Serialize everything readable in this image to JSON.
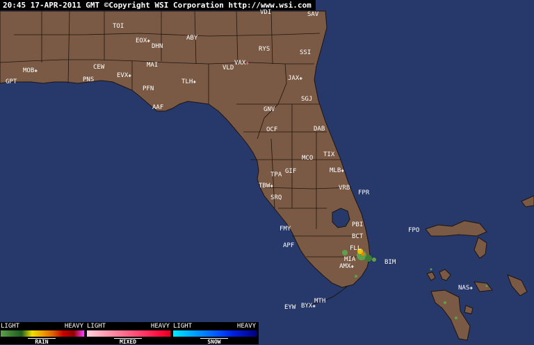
{
  "header": {
    "text": "20:45 17-APR-2011 GMT ©Copyright WSI Corporation  http://www.wsi.com"
  },
  "colors": {
    "water": "#27386a",
    "land": "#7a5a44",
    "border": "#1e1410",
    "text": "#ffffff",
    "station_marker": "#ffffff",
    "highlight_marker": "#ff69b4"
  },
  "stations": [
    {
      "code": "VDI",
      "marker": false
    },
    {
      "code": "SAV",
      "marker": false
    },
    {
      "code": "TOI",
      "marker": false
    },
    {
      "code": "EOX",
      "marker": true
    },
    {
      "code": "DHN",
      "marker": false
    },
    {
      "code": "ABY",
      "marker": false
    },
    {
      "code": "RYS",
      "marker": false
    },
    {
      "code": "SSI",
      "marker": false
    },
    {
      "code": "MOB",
      "marker": true
    },
    {
      "code": "CEW",
      "marker": false
    },
    {
      "code": "MAI",
      "marker": false
    },
    {
      "code": "VAX",
      "marker": true,
      "highlight": true
    },
    {
      "code": "VLD",
      "marker": false
    },
    {
      "code": "EVX",
      "marker": true
    },
    {
      "code": "GPT",
      "marker": false
    },
    {
      "code": "PNS",
      "marker": false
    },
    {
      "code": "PFN",
      "marker": false
    },
    {
      "code": "TLH",
      "marker": true
    },
    {
      "code": "JAX",
      "marker": true
    },
    {
      "code": "SGJ",
      "marker": false
    },
    {
      "code": "AAF",
      "marker": false
    },
    {
      "code": "GNV",
      "marker": false
    },
    {
      "code": "OCF",
      "marker": false
    },
    {
      "code": "DAB",
      "marker": false
    },
    {
      "code": "TIX",
      "marker": false
    },
    {
      "code": "MCO",
      "marker": false
    },
    {
      "code": "MLB",
      "marker": true
    },
    {
      "code": "GIF",
      "marker": false
    },
    {
      "code": "TPA",
      "marker": false
    },
    {
      "code": "TBW",
      "marker": true
    },
    {
      "code": "VRB",
      "marker": false
    },
    {
      "code": "FPR",
      "marker": false
    },
    {
      "code": "SRQ",
      "marker": false
    },
    {
      "code": "PBI",
      "marker": false
    },
    {
      "code": "FMY",
      "marker": false
    },
    {
      "code": "FPO",
      "marker": false
    },
    {
      "code": "BCT",
      "marker": false
    },
    {
      "code": "APF",
      "marker": false
    },
    {
      "code": "FLL",
      "marker": false
    },
    {
      "code": "MIA",
      "marker": false
    },
    {
      "code": "BIM",
      "marker": false
    },
    {
      "code": "AMX",
      "marker": true
    },
    {
      "code": "NAS",
      "marker": true
    },
    {
      "code": "MTH",
      "marker": false
    },
    {
      "code": "EYW",
      "marker": false
    },
    {
      "code": "BYX",
      "marker": true
    }
  ],
  "legend": [
    {
      "light": "LIGHT",
      "heavy": "HEAVY",
      "name": "RAIN",
      "colors": [
        "#5fa04c",
        "#3c7d34",
        "#1f5c1f",
        "#f0e000",
        "#f0a000",
        "#e06000",
        "#c80000",
        "#900000",
        "#ff40ff"
      ]
    },
    {
      "light": "LIGHT",
      "heavy": "HEAVY",
      "name": "MIXED",
      "colors": [
        "#ffd0d8",
        "#ffb0c0",
        "#ff90a8",
        "#ff7090",
        "#ff5078",
        "#ff3060",
        "#ff1040",
        "#e00020"
      ]
    },
    {
      "light": "LIGHT",
      "heavy": "HEAVY",
      "name": "SNOW",
      "colors": [
        "#00e8ff",
        "#00c0ff",
        "#0098ff",
        "#0070ff",
        "#0048ff",
        "#0020e0",
        "#0010b0",
        "#000080"
      ]
    }
  ]
}
